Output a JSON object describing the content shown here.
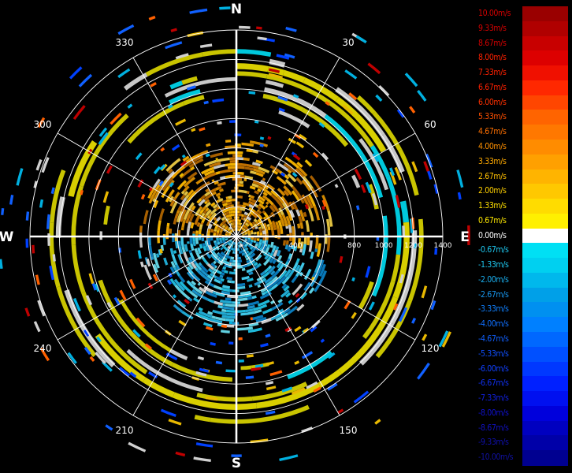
{
  "chart_data": {
    "type": "polar-ppi",
    "title": "",
    "compass": [
      "N",
      "E",
      "S",
      "W"
    ],
    "angle_ticks": [
      30,
      60,
      120,
      150,
      210,
      240,
      300,
      330
    ],
    "range_labels": [
      "400",
      "800",
      "1000",
      "1200",
      "1400"
    ],
    "range_rings": [
      200,
      400,
      600,
      800,
      1000,
      1200,
      1400
    ],
    "range_max": 1400,
    "spokes_deg": [
      0,
      30,
      60,
      90,
      120,
      150,
      180,
      210,
      240,
      270,
      300,
      330
    ],
    "grid": true,
    "rings": [
      {
        "range": [
          1240,
          1270
        ],
        "color": "#c9c400",
        "cover": 0.55,
        "seed": 11
      },
      {
        "range": [
          1190,
          1225
        ],
        "color": "#c8c8c8",
        "cover": 0.35,
        "seed": 12
      },
      {
        "range": [
          1135,
          1175
        ],
        "color": "#d9cf00",
        "cover": 0.75,
        "seed": 13
      },
      {
        "range": [
          1090,
          1120
        ],
        "color": "#c9c400",
        "cover": 0.55,
        "seed": 14
      },
      {
        "range": [
          1055,
          1080
        ],
        "color": "#c8c8c8",
        "cover": 0.3,
        "seed": 15
      },
      {
        "range": [
          1000,
          1030
        ],
        "color": "#00c8dc",
        "cover": 0.3,
        "seed": 16
      },
      {
        "range": [
          955,
          985
        ],
        "color": "#c9c400",
        "cover": 0.35,
        "seed": 17
      },
      {
        "range": [
          880,
          905
        ],
        "color": "#c9c400",
        "cover": 0.25,
        "seed": 18
      }
    ],
    "inner_echo": {
      "range": [
        40,
        660
      ],
      "north_color": "#e8a000",
      "south_color": "#1fb8d8"
    },
    "scatter_colors": [
      "#c00000",
      "#ff6000",
      "#0040ff",
      "#00b0e0",
      "#e8b800",
      "#1060ff",
      "#d0d0d0"
    ]
  },
  "legend": {
    "labels": [
      "10.00m/s",
      "9.33m/s",
      "8.67m/s",
      "8.00m/s",
      "7.33m/s",
      "6.67m/s",
      "6.00m/s",
      "5.33m/s",
      "4.67m/s",
      "4.00m/s",
      "3.33m/s",
      "2.67m/s",
      "2.00m/s",
      "1.33m/s",
      "0.67m/s",
      "0.00m/s",
      "-0.67m/s",
      "-1.33m/s",
      "-2.00m/s",
      "-2.67m/s",
      "-3.33m/s",
      "-4.00m/s",
      "-4.67m/s",
      "-5.33m/s",
      "-6.00m/s",
      "-6.67m/s",
      "-7.33m/s",
      "-8.00m/s",
      "-8.67m/s",
      "-9.33m/s",
      "-10.00m/s"
    ],
    "colors": [
      "#9a0000",
      "#b00000",
      "#c80000",
      "#dd0000",
      "#f01000",
      "#ff2800",
      "#ff4600",
      "#ff6400",
      "#ff7800",
      "#ff8c00",
      "#ffa000",
      "#ffb400",
      "#ffc800",
      "#ffdc00",
      "#fff000",
      "#ffffff",
      "#00e0f4",
      "#00d0f0",
      "#00b8ec",
      "#00a0e8",
      "#0090f0",
      "#0080ff",
      "#0068ff",
      "#0050ff",
      "#0038ff",
      "#0020ff",
      "#0010f0",
      "#0000dc",
      "#0000c0",
      "#0000a8",
      "#000090"
    ],
    "label_colors": [
      "#d60000",
      "#d60000",
      "#d60000",
      "#ff2000",
      "#ff2000",
      "#ff2000",
      "#ff3000",
      "#ff5000",
      "#ff7000",
      "#ff9000",
      "#ffaa00",
      "#ffc000",
      "#ffd000",
      "#ffe000",
      "#ffe800",
      "#ffffff",
      "#1ec8f0",
      "#1ec8f0",
      "#1ab0f0",
      "#1898f0",
      "#1080ff",
      "#1070ff",
      "#1060ff",
      "#1050ff",
      "#1040ff",
      "#1030f0",
      "#1020e0",
      "#1010d0",
      "#1010c0",
      "#1010b0",
      "#1010a0"
    ]
  }
}
